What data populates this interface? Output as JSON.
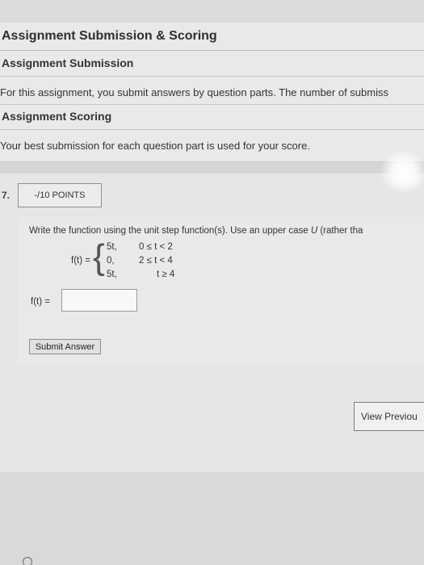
{
  "section_title": "Assignment Submission & Scoring",
  "submission": {
    "heading": "Assignment Submission",
    "text": "For this assignment, you submit answers by question parts. The number of submiss"
  },
  "scoring": {
    "heading": "Assignment Scoring",
    "text": "Your best submission for each question part is used for your score."
  },
  "question": {
    "number": "7.",
    "points": "-/10 POINTS",
    "prompt_before": "Write the function using the unit step function(s). Use an upper case ",
    "prompt_var": "U",
    "prompt_after": " (rather tha",
    "function_label": "f(t) =",
    "cases": [
      {
        "value": "5t,",
        "condition": "0 ≤ t < 2"
      },
      {
        "value": "0,",
        "condition": "2 ≤ t < 4"
      },
      {
        "value": "5t,",
        "condition": "t ≥ 4"
      }
    ],
    "answer_label": "f(t) =",
    "answer_value": "",
    "submit_label": "Submit Answer"
  },
  "view_previous_label": "View Previou"
}
